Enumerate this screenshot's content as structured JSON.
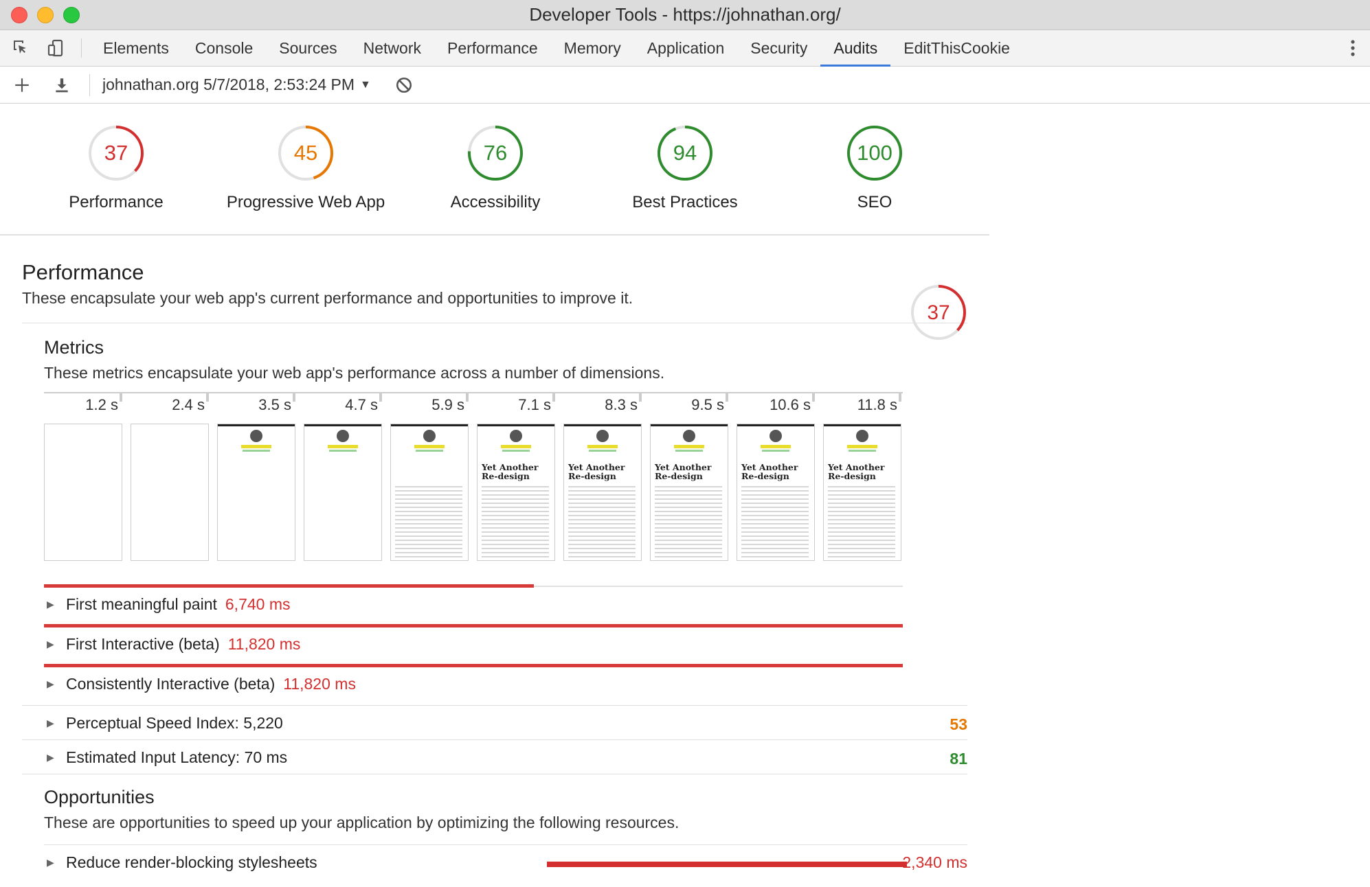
{
  "window": {
    "title": "Developer Tools - https://johnathan.org/"
  },
  "tabs": [
    {
      "label": "Elements"
    },
    {
      "label": "Console"
    },
    {
      "label": "Sources"
    },
    {
      "label": "Network"
    },
    {
      "label": "Performance"
    },
    {
      "label": "Memory"
    },
    {
      "label": "Application"
    },
    {
      "label": "Security"
    },
    {
      "label": "Audits",
      "active": true
    },
    {
      "label": "EditThisCookie"
    }
  ],
  "toolbar": {
    "report": "johnathan.org 5/7/2018, 2:53:24 PM"
  },
  "gauges": [
    {
      "score": "37",
      "label": "Performance",
      "color": "#d32f2f"
    },
    {
      "score": "45",
      "label": "Progressive Web App",
      "color": "#e67700"
    },
    {
      "score": "76",
      "label": "Accessibility",
      "color": "#2e8b2e"
    },
    {
      "score": "94",
      "label": "Best Practices",
      "color": "#2e8b2e"
    },
    {
      "score": "100",
      "label": "SEO",
      "color": "#2e8b2e"
    }
  ],
  "performance": {
    "title": "Performance",
    "description": "These encapsulate your web app's current performance and opportunities to improve it.",
    "score": "37",
    "metrics_title": "Metrics",
    "metrics_description": "These metrics encapsulate your web app's performance across a number of dimensions.",
    "filmstrip": {
      "times": [
        "1.2 s",
        "2.4 s",
        "3.5 s",
        "4.7 s",
        "5.9 s",
        "7.1 s",
        "8.3 s",
        "9.5 s",
        "10.6 s",
        "11.8 s"
      ],
      "frame_heading": "Yet Another Re-design"
    },
    "metrics": [
      {
        "label": "First meaningful paint",
        "value": "6,740 ms",
        "fraction": 0.57
      },
      {
        "label": "First Interactive (beta)",
        "value": "11,820 ms",
        "fraction": 1.0
      },
      {
        "label": "Consistently Interactive (beta)",
        "value": "11,820 ms",
        "fraction": 1.0
      }
    ],
    "lite_metrics": [
      {
        "label": "Perceptual Speed Index: 5,220",
        "score": "53",
        "color": "#e67700"
      },
      {
        "label": "Estimated Input Latency: 70 ms",
        "score": "81",
        "color": "#2e8b2e"
      }
    ],
    "opportunities_title": "Opportunities",
    "opportunities_description": "These are opportunities to speed up your application by optimizing the following resources.",
    "opportunities": [
      {
        "label": "Reduce render-blocking stylesheets",
        "value": "2,340 ms"
      }
    ]
  }
}
